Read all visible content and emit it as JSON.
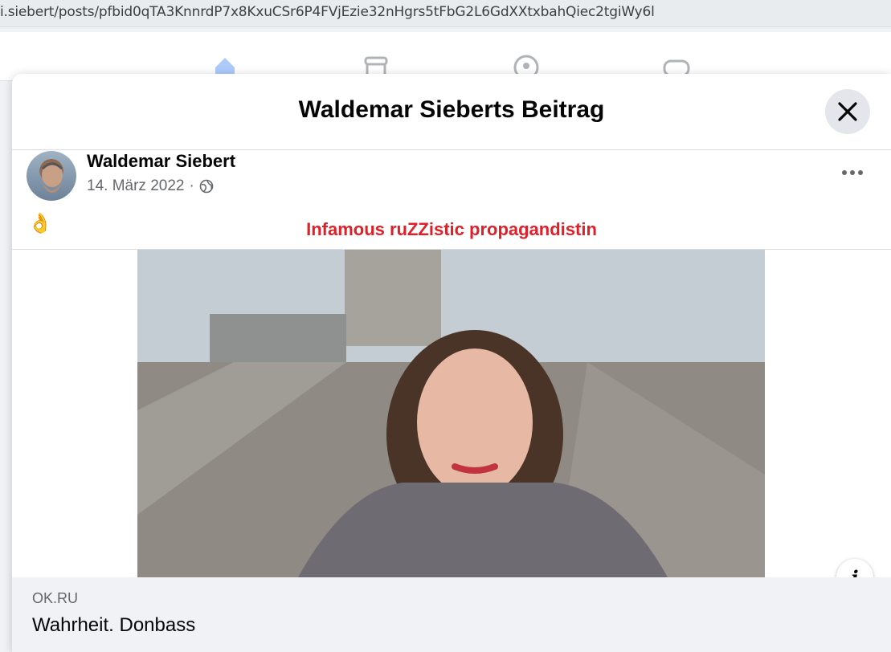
{
  "browser": {
    "url": "i.siebert/posts/pfbid0qTA3KnnrdP7x8KxuCSr6P4FVjEzie32nHgrs5tFbG2L6GdXXtxbahQiec2tgiWy6l"
  },
  "nav": {
    "icons": [
      "home-icon",
      "marketplace-icon",
      "groups-icon",
      "gaming-icon"
    ],
    "active": "home-icon",
    "accent": "#1877f2"
  },
  "modal": {
    "title": "Waldemar Sieberts Beitrag",
    "close_icon": "close-icon"
  },
  "post": {
    "author": "Waldemar Siebert",
    "date": "14. März 2022",
    "separator": "·",
    "audience_icon": "globe-icon",
    "text": "👌",
    "more_icon": "more-horizontal-icon"
  },
  "link_preview": {
    "image_caption": "Infamous ruZZistic propagandistin",
    "caption_color": "#e02029",
    "info_icon": "info-icon",
    "info_label": "i",
    "domain": "OK.RU",
    "title": "Wahrheit. Donbass"
  }
}
